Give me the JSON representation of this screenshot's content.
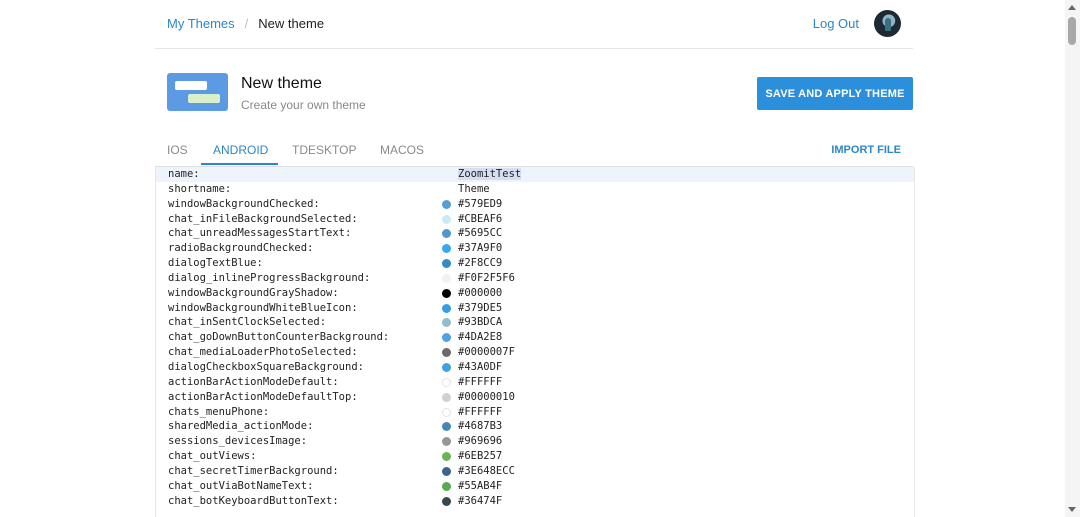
{
  "breadcrumb": {
    "root": "My Themes",
    "separator": "/",
    "current": "New theme"
  },
  "header": {
    "logout": "Log Out"
  },
  "theme": {
    "title": "New theme",
    "subtitle": "Create your own theme",
    "save_label": "SAVE AND APPLY THEME"
  },
  "tabs": [
    {
      "label": "IOS",
      "active": false
    },
    {
      "label": "ANDROID",
      "active": true
    },
    {
      "label": "TDESKTOP",
      "active": false
    },
    {
      "label": "MACOS",
      "active": false
    }
  ],
  "import_label": "IMPORT FILE",
  "rows": [
    {
      "key": "name:",
      "value": "ZoomitTest",
      "color": ""
    },
    {
      "key": "shortname:",
      "value": "Theme",
      "color": ""
    },
    {
      "key": "windowBackgroundChecked:",
      "value": "#579ED9",
      "color": "#579ED9"
    },
    {
      "key": "chat_inFileBackgroundSelected:",
      "value": "#CBEAF6",
      "color": "#CBEAF6"
    },
    {
      "key": "chat_unreadMessagesStartText:",
      "value": "#5695CC",
      "color": "#5695CC"
    },
    {
      "key": "radioBackgroundChecked:",
      "value": "#37A9F0",
      "color": "#37A9F0"
    },
    {
      "key": "dialogTextBlue:",
      "value": "#2F8CC9",
      "color": "#2F8CC9"
    },
    {
      "key": "dialog_inlineProgressBackground:",
      "value": "#F0F2F5F6",
      "color": "#F0F2F5"
    },
    {
      "key": "windowBackgroundGrayShadow:",
      "value": "#000000",
      "color": "#000000"
    },
    {
      "key": "windowBackgroundWhiteBlueIcon:",
      "value": "#379DE5",
      "color": "#379DE5"
    },
    {
      "key": "chat_inSentClockSelected:",
      "value": "#93BDCA",
      "color": "#93BDCA"
    },
    {
      "key": "chat_goDownButtonCounterBackground:",
      "value": "#4DA2E8",
      "color": "#4DA2E8"
    },
    {
      "key": "chat_mediaLoaderPhotoSelected:",
      "value": "#0000007F",
      "color": "#6b6b6b"
    },
    {
      "key": "dialogCheckboxSquareBackground:",
      "value": "#43A0DF",
      "color": "#43A0DF"
    },
    {
      "key": "actionBarActionModeDefault:",
      "value": "#FFFFFF",
      "color": "#FFFFFF"
    },
    {
      "key": "actionBarActionModeDefaultTop:",
      "value": "#00000010",
      "color": "#d0d0d0"
    },
    {
      "key": "chats_menuPhone:",
      "value": "#FFFFFF",
      "color": "#FFFFFF"
    },
    {
      "key": "sharedMedia_actionMode:",
      "value": "#4687B3",
      "color": "#4687B3"
    },
    {
      "key": "sessions_devicesImage:",
      "value": "#969696",
      "color": "#969696"
    },
    {
      "key": "chat_outViews:",
      "value": "#6EB257",
      "color": "#6EB257"
    },
    {
      "key": "chat_secretTimerBackground:",
      "value": "#3E648ECC",
      "color": "#3E648E"
    },
    {
      "key": "chat_outViaBotNameText:",
      "value": "#55AB4F",
      "color": "#55AB4F"
    },
    {
      "key": "chat_botKeyboardButtonText:",
      "value": "#36474F",
      "color": "#36474F"
    }
  ]
}
